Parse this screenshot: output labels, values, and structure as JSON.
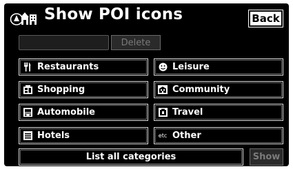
{
  "header": {
    "title": "Show POI icons",
    "back_label": "Back",
    "title_icon": "poi-map-icon"
  },
  "edit_row": {
    "name_value": "",
    "delete_label": "Delete"
  },
  "categories": [
    {
      "label": "Restaurants",
      "icon": "fork-knife-icon"
    },
    {
      "label": "Leisure",
      "icon": "smiley-icon"
    },
    {
      "label": "Shopping",
      "icon": "shopping-bag-icon"
    },
    {
      "label": "Community",
      "icon": "building-icon"
    },
    {
      "label": "Automobile",
      "icon": "car-icon"
    },
    {
      "label": "Travel",
      "icon": "luggage-icon"
    },
    {
      "label": "Hotels",
      "icon": "bed-icon"
    },
    {
      "label": "Other",
      "icon": "etc-icon",
      "icon_text": "etc"
    }
  ],
  "footer": {
    "list_all_label": "List all categories",
    "show_label": "Show"
  },
  "colors": {
    "screen_bg": "#000000",
    "text": "#ffffff",
    "disabled_text": "#7a7a7a",
    "button_border": "#d8d8d8"
  }
}
